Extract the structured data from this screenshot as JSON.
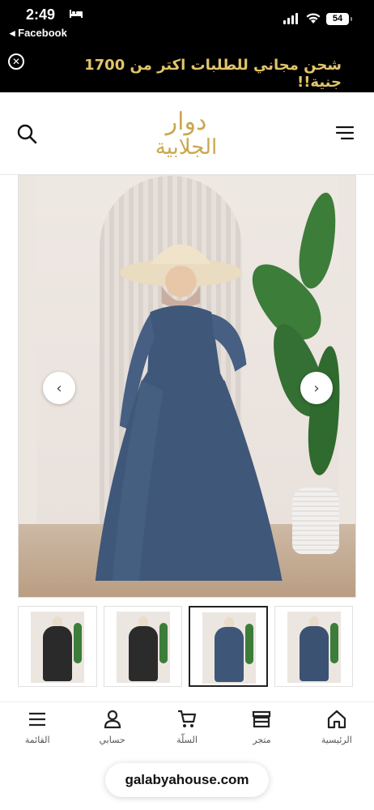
{
  "status_bar": {
    "time": "2:49",
    "back_app": "◂ Facebook",
    "battery": "54",
    "icons": [
      "bed-icon",
      "signal-icon",
      "wifi-icon",
      "battery-icon"
    ]
  },
  "promo": {
    "text": "شحن مجاني للطلبات اكتر من 1700 جنية!!",
    "close_icon": "close-circle-icon",
    "text_color": "#e2c46a"
  },
  "header": {
    "logo_line1": "دوار",
    "logo_line2": "الجلابية",
    "logo_color": "#c9a94e",
    "left_icon": "search-icon",
    "right_icon": "menu-icon"
  },
  "gallery": {
    "prev_icon": "chevron-left-icon",
    "next_icon": "chevron-right-icon",
    "thumbnails": [
      {
        "dress_color": "#2a2a2a",
        "active": false
      },
      {
        "dress_color": "#2b2b2b",
        "active": false
      },
      {
        "dress_color": "#3e5678",
        "active": true
      },
      {
        "dress_color": "#3b5272",
        "active": false
      }
    ]
  },
  "bottom_nav": {
    "items": [
      {
        "label": "القائمة",
        "icon": "menu-icon"
      },
      {
        "label": "حسابي",
        "icon": "user-icon"
      },
      {
        "label": "السلّة",
        "icon": "cart-icon"
      },
      {
        "label": "متجر",
        "icon": "store-icon"
      },
      {
        "label": "الرئيسية",
        "icon": "home-icon"
      }
    ]
  },
  "browser": {
    "url": "galabyahouse.com"
  }
}
